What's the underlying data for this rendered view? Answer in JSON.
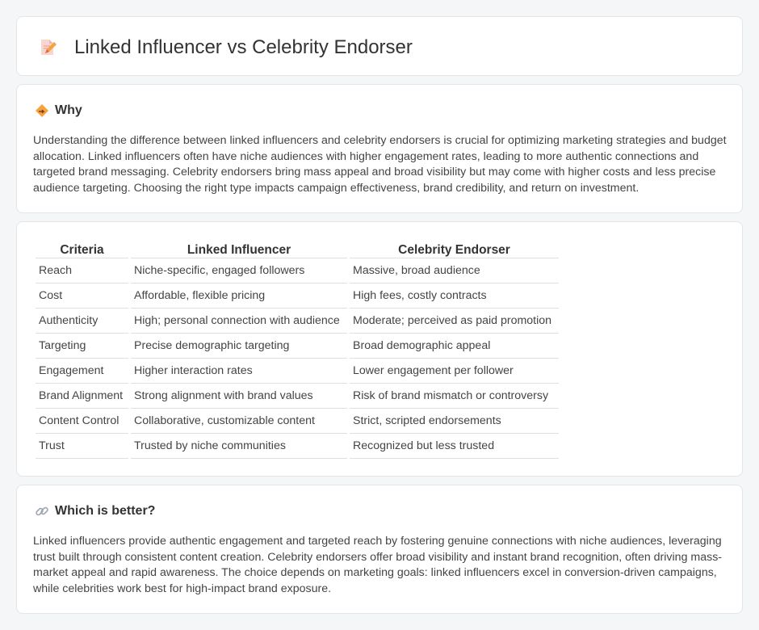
{
  "header": {
    "title": "Linked Influencer vs Celebrity Endorser"
  },
  "why": {
    "heading": "Why",
    "body": "Understanding the difference between linked influencers and celebrity endorsers is crucial for optimizing marketing strategies and budget allocation. Linked influencers often have niche audiences with higher engagement rates, leading to more authentic connections and targeted brand messaging. Celebrity endorsers bring mass appeal and broad visibility but may come with higher costs and less precise audience targeting. Choosing the right type impacts campaign effectiveness, brand credibility, and return on investment."
  },
  "table": {
    "headers": [
      "Criteria",
      "Linked Influencer",
      "Celebrity Endorser"
    ],
    "rows": [
      [
        "Reach",
        "Niche-specific, engaged followers",
        "Massive, broad audience"
      ],
      [
        "Cost",
        "Affordable, flexible pricing",
        "High fees, costly contracts"
      ],
      [
        "Authenticity",
        "High; personal connection with audience",
        "Moderate; perceived as paid promotion"
      ],
      [
        "Targeting",
        "Precise demographic targeting",
        "Broad demographic appeal"
      ],
      [
        "Engagement",
        "Higher interaction rates",
        "Lower engagement per follower"
      ],
      [
        "Brand Alignment",
        "Strong alignment with brand values",
        "Risk of brand mismatch or controversy"
      ],
      [
        "Content Control",
        "Collaborative, customizable content",
        "Strict, scripted endorsements"
      ],
      [
        "Trust",
        "Trusted by niche communities",
        "Recognized but less trusted"
      ]
    ]
  },
  "better": {
    "heading": "Which is better?",
    "body": "Linked influencers provide authentic engagement and targeted reach by fostering genuine connections with niche audiences, leveraging trust built through consistent content creation. Celebrity endorsers offer broad visibility and instant brand recognition, often driving mass-market appeal and rapid awareness. The choice depends on marketing goals: linked influencers excel in conversion-driven campaigns, while celebrities work best for high-impact brand exposure."
  },
  "icons": {
    "title": "document-pencil-icon",
    "why": "diamond-sign-icon",
    "better": "link-icon"
  },
  "colors": {
    "page_bg": "#f5f6f8",
    "card_bg": "#ffffff",
    "icon_orange": "#f4a340",
    "icon_red": "#e8604c",
    "link_gray": "#9aa3b0"
  }
}
